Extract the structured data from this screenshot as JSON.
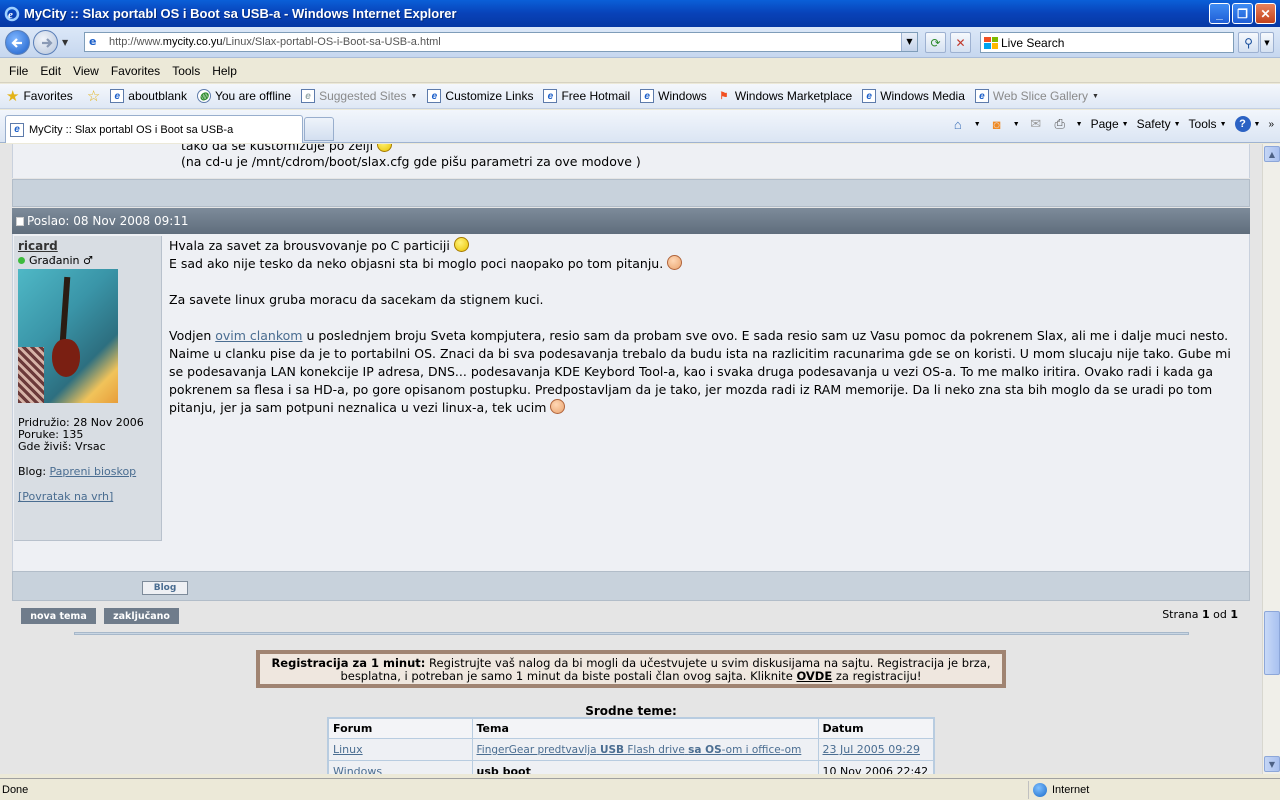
{
  "window": {
    "title": "MyCity :: Slax portabl OS i Boot sa USB-a - Windows Internet Explorer"
  },
  "address": {
    "url_prefix": "http://www.",
    "url_domain": "mycity.co.yu",
    "url_path": "/Linux/Slax-portabl-OS-i-Boot-sa-USB-a.html",
    "search_placeholder": "Live Search"
  },
  "menu": [
    "File",
    "Edit",
    "View",
    "Favorites",
    "Tools",
    "Help"
  ],
  "favorites_bar": {
    "favorites_label": "Favorites",
    "items": [
      "aboutblank",
      "You are offline",
      "Suggested Sites",
      "Customize Links",
      "Free Hotmail",
      "Windows",
      "Windows Marketplace",
      "Windows Media",
      "Web Slice Gallery"
    ]
  },
  "tab": {
    "title": "MyCity :: Slax portabl OS i Boot sa USB-a"
  },
  "command_bar": {
    "page": "Page",
    "safety": "Safety",
    "tools": "Tools"
  },
  "previous_post": {
    "line1": "tako da se kustomizuje po zelji",
    "line2": "(na cd-u je /mnt/cdrom/boot/slax.cfg gde pišu parametri za ove modove )"
  },
  "post": {
    "header": "Poslao: 08 Nov 2008 09:11",
    "user": {
      "name": "ricard",
      "rank": "Građanin ♂",
      "joined": "Pridružio: 28 Nov 2006",
      "posts": "Poruke: 135",
      "location": "Gde živiš: Vrsac",
      "blog_label": "Blog:",
      "blog_link": "Papreni bioskop",
      "back_link": "[Povratak na vrh]"
    },
    "p1": "Hvala za savet za brousvovanje po C particiji",
    "p2": "E sad ako nije tesko da neko objasni sta bi moglo poci naopako po tom pitanju.",
    "p3": "Za savete linux gruba moracu da sacekam da stignem kuci.",
    "p4_before": "Vodjen",
    "p4_link": "ovim clankom",
    "p4_line1": "u poslednjem broju Sveta kompjutera, resio sam da probam sve ovo. E sada resio sam uz Vasu pomoc da pokrenem Slax, ali me i dalje muci nesto.",
    "p4_line2": "Naime u clanku pise da je to portabilni OS. Znaci da bi sva podesavanja trebalo da budu ista na razlicitim racunarima gde se on koristi. U mom slucaju nije tako. Gube mi",
    "p4_line3": "se podesavanja LAN konekcije IP adresa, DNS... podesavanja KDE Keybord Tool-a, kao i svaka druga podesavanja u vezi OS-a. To me malko iritira. Ovako radi i kada ga",
    "p4_line4": "pokrenem sa flesa i sa HD-a, po gore opisanom postupku. Predpostavljam da je tako, jer mozda radi iz RAM memorije. Da li neko zna sta bih moglo da se uradi po tom",
    "p4_line5": "pitanju, jer ja sam potpuni neznalica u vezi linux-a, tek ucim"
  },
  "footer": {
    "blog_button": "Blog",
    "new_topic": "nova tema",
    "locked": "zaključano",
    "pages_prefix": "Strana",
    "page_current": "1",
    "pages_of": "od",
    "page_total": "1"
  },
  "registration": {
    "bold": "Registracija za 1 minut:",
    "text1": "Registrujte vaš nalog da bi mogli da učestvujete u svim diskusijama na sajtu. Registracija je brza,",
    "text2a": "besplatna, i potreban je samo 1 minut da biste postali član ovog sajta. Kliknite",
    "link": "OVDE",
    "text2b": "za registraciju!"
  },
  "related": {
    "title": "Srodne teme:",
    "headers": [
      "Forum",
      "Tema",
      "Datum"
    ],
    "rows": [
      {
        "forum": "Linux",
        "topic_a": "FingerGear predtvavlja",
        "topic_b": "USB",
        "topic_c": "Flash drive",
        "topic_d": "sa OS",
        "topic_e": "-om i office-om",
        "date": "23 Jul 2005 09:29"
      },
      {
        "forum": "Windows",
        "topic_a": "usb boot",
        "topic_b": "",
        "topic_c": "",
        "topic_d": "",
        "topic_e": "",
        "date": "10 Nov 2006 22:42"
      }
    ]
  },
  "status": {
    "left": "Done",
    "zone": "Internet"
  }
}
